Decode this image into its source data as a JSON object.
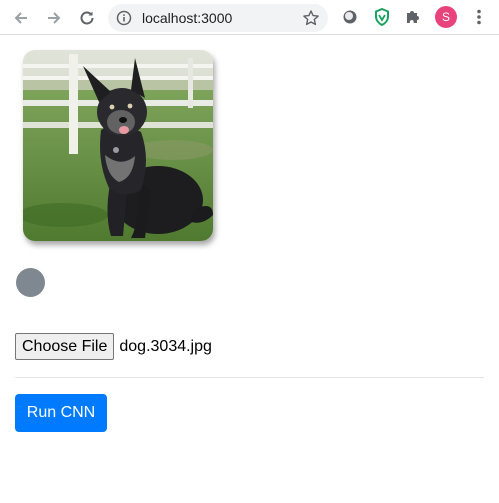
{
  "browser": {
    "url": "localhost:3000",
    "profile_initial": "S",
    "icons": {
      "back": "arrow-left-icon",
      "forward": "arrow-right-icon",
      "reload": "reload-icon",
      "site_info": "info-icon",
      "bookmark": "star-icon",
      "extension_1": "circle-extension-icon",
      "extension_2": "shield-extension-icon",
      "extensions": "puzzle-icon",
      "menu": "kebab-menu-icon"
    },
    "colors": {
      "profile_avatar": "#e8437b",
      "shield_extension": "#1aa260"
    }
  },
  "page": {
    "image": {
      "subject": "dog photo"
    },
    "status_indicator": {
      "color": "#7f8790"
    },
    "file_input": {
      "button_label": "Choose File",
      "file_name": "dog.3034.jpg"
    },
    "run_button": {
      "label": "Run CNN",
      "color": "#007bff"
    }
  }
}
